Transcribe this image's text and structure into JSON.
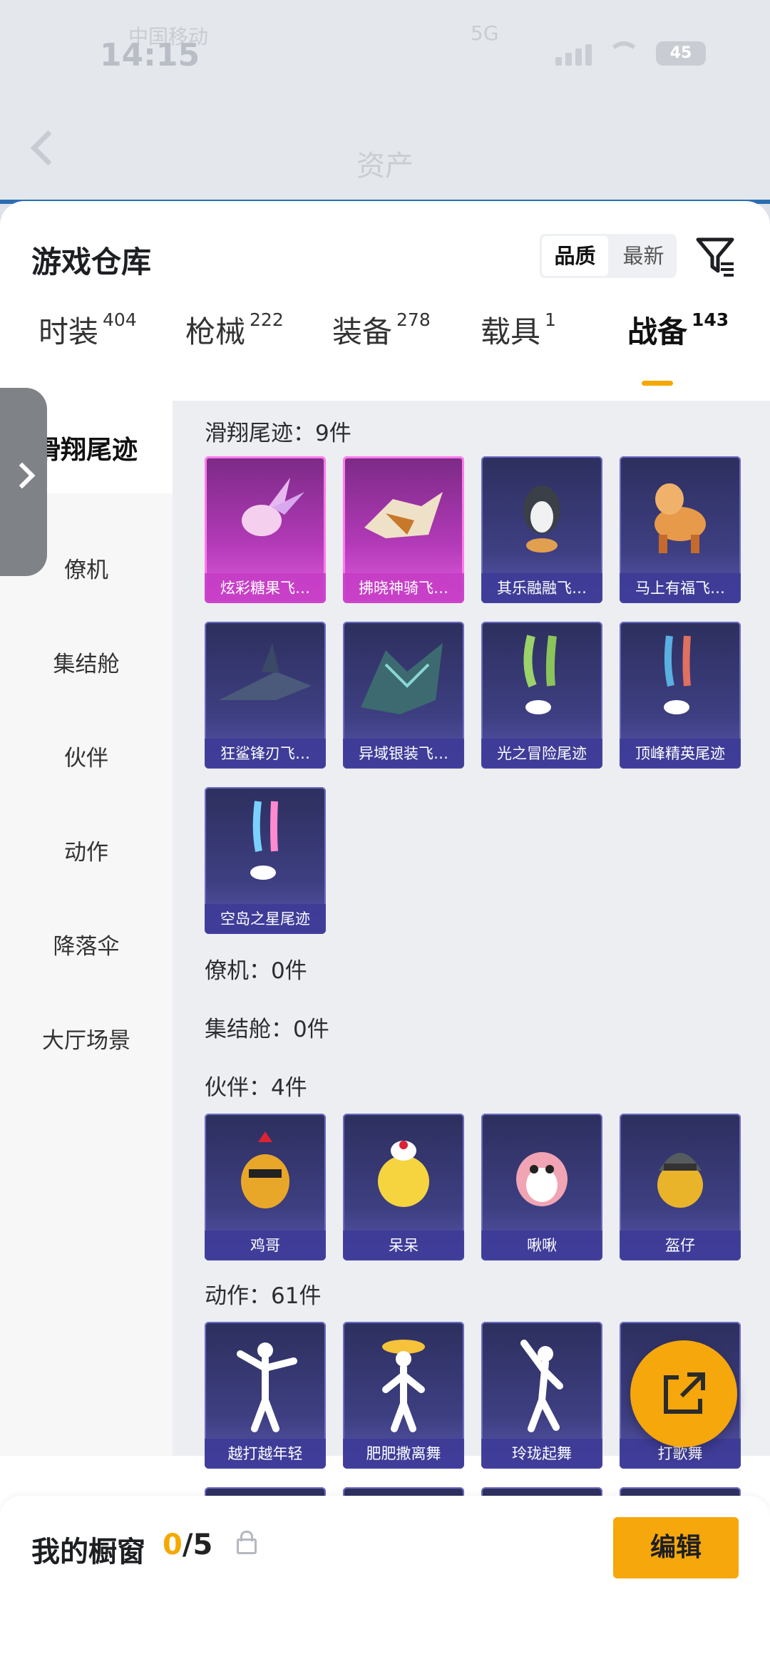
{
  "status": {
    "time": "14:15",
    "carrier": "中国移动",
    "net": "5G",
    "battery": "45"
  },
  "topbar": {
    "title": "资产"
  },
  "header": {
    "title": "游戏仓库",
    "sort_quality": "品质",
    "sort_new": "最新"
  },
  "tabs": [
    {
      "label": "时装",
      "count": "404"
    },
    {
      "label": "枪械",
      "count": "222"
    },
    {
      "label": "装备",
      "count": "278"
    },
    {
      "label": "载具",
      "count": "1"
    },
    {
      "label": "战备",
      "count": "143"
    }
  ],
  "categories": [
    "滑翔尾迹",
    "僚机",
    "集结舱",
    "伙伴",
    "动作",
    "降落伞",
    "大厅场景"
  ],
  "sections": {
    "glide": {
      "title": "滑翔尾迹：9件",
      "items": [
        "炫彩糖果飞…",
        "拂晓神骑飞…",
        "其乐融融飞…",
        "马上有福飞…",
        "狂鲨锋刃飞…",
        "异域银装飞…",
        "光之冒险尾迹",
        "顶峰精英尾迹",
        "空岛之星尾迹"
      ]
    },
    "wingman": {
      "title": "僚机：0件"
    },
    "pod": {
      "title": "集结舱：0件"
    },
    "partner": {
      "title": "伙伴：4件",
      "items": [
        "鸡哥",
        "呆呆",
        "啾啾",
        "盔仔"
      ]
    },
    "action": {
      "title": "动作：61件",
      "items": [
        "越打越年轻",
        "肥肥撒离舞",
        "玲珑起舞",
        "打歌舞"
      ]
    }
  },
  "bottom": {
    "label": "我的橱窗",
    "count_used": "0",
    "count_total": "/5",
    "edit": "编辑"
  },
  "colors": {
    "accent": "#f5a70b",
    "purple_card": "#3e3f82",
    "pink_card": "#b33ab8"
  }
}
